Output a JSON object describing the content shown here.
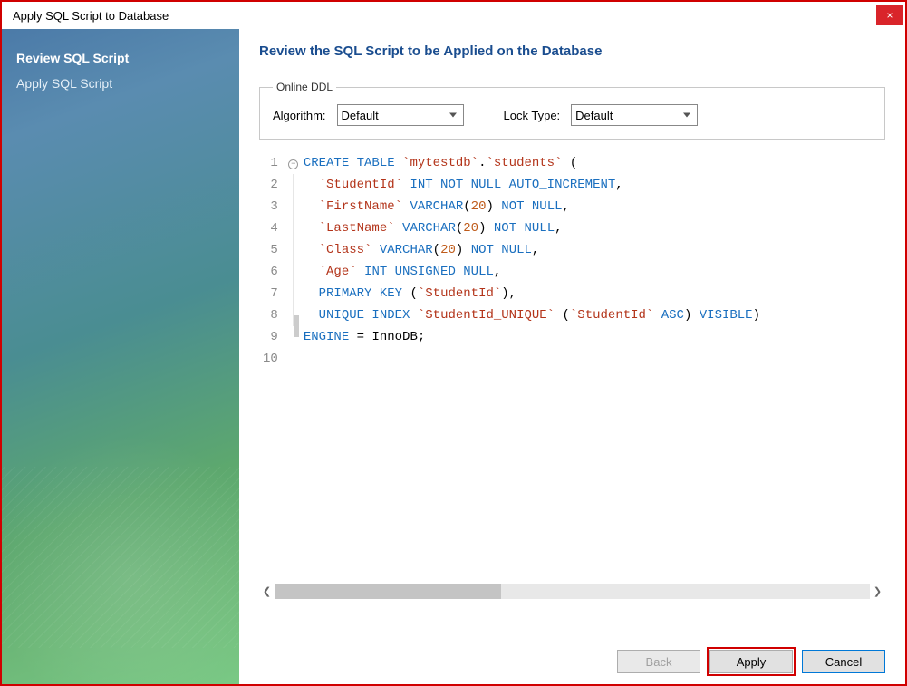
{
  "window": {
    "title": "Apply SQL Script to Database",
    "close_label": "×"
  },
  "sidebar": {
    "items": [
      {
        "label": "Review SQL Script",
        "active": true
      },
      {
        "label": "Apply SQL Script",
        "active": false
      }
    ]
  },
  "main": {
    "heading": "Review the SQL Script to be Applied on the Database",
    "fieldset": {
      "legend": "Online DDL",
      "algorithm_label": "Algorithm:",
      "algorithm_value": "Default",
      "locktype_label": "Lock Type:",
      "locktype_value": "Default"
    },
    "code": {
      "gutter": [
        "1",
        "2",
        "3",
        "4",
        "5",
        "6",
        "7",
        "8",
        "9",
        "10"
      ],
      "lines": [
        [
          {
            "t": "kw",
            "v": "CREATE TABLE"
          },
          {
            "t": "plain",
            "v": " "
          },
          {
            "t": "id",
            "v": "`mytestdb`"
          },
          {
            "t": "plain",
            "v": "."
          },
          {
            "t": "id",
            "v": "`students`"
          },
          {
            "t": "plain",
            "v": " ("
          }
        ],
        [
          {
            "t": "plain",
            "v": "  "
          },
          {
            "t": "id",
            "v": "`StudentId`"
          },
          {
            "t": "plain",
            "v": " "
          },
          {
            "t": "kw",
            "v": "INT NOT NULL AUTO_INCREMENT"
          },
          {
            "t": "plain",
            "v": ","
          }
        ],
        [
          {
            "t": "plain",
            "v": "  "
          },
          {
            "t": "id",
            "v": "`FirstName`"
          },
          {
            "t": "plain",
            "v": " "
          },
          {
            "t": "kw",
            "v": "VARCHAR"
          },
          {
            "t": "plain",
            "v": "("
          },
          {
            "t": "num",
            "v": "20"
          },
          {
            "t": "plain",
            "v": ") "
          },
          {
            "t": "kw",
            "v": "NOT NULL"
          },
          {
            "t": "plain",
            "v": ","
          }
        ],
        [
          {
            "t": "plain",
            "v": "  "
          },
          {
            "t": "id",
            "v": "`LastName`"
          },
          {
            "t": "plain",
            "v": " "
          },
          {
            "t": "kw",
            "v": "VARCHAR"
          },
          {
            "t": "plain",
            "v": "("
          },
          {
            "t": "num",
            "v": "20"
          },
          {
            "t": "plain",
            "v": ") "
          },
          {
            "t": "kw",
            "v": "NOT NULL"
          },
          {
            "t": "plain",
            "v": ","
          }
        ],
        [
          {
            "t": "plain",
            "v": "  "
          },
          {
            "t": "id",
            "v": "`Class`"
          },
          {
            "t": "plain",
            "v": " "
          },
          {
            "t": "kw",
            "v": "VARCHAR"
          },
          {
            "t": "plain",
            "v": "("
          },
          {
            "t": "num",
            "v": "20"
          },
          {
            "t": "plain",
            "v": ") "
          },
          {
            "t": "kw",
            "v": "NOT NULL"
          },
          {
            "t": "plain",
            "v": ","
          }
        ],
        [
          {
            "t": "plain",
            "v": "  "
          },
          {
            "t": "id",
            "v": "`Age`"
          },
          {
            "t": "plain",
            "v": " "
          },
          {
            "t": "kw",
            "v": "INT UNSIGNED NULL"
          },
          {
            "t": "plain",
            "v": ","
          }
        ],
        [
          {
            "t": "plain",
            "v": "  "
          },
          {
            "t": "kw",
            "v": "PRIMARY KEY"
          },
          {
            "t": "plain",
            "v": " ("
          },
          {
            "t": "id",
            "v": "`StudentId`"
          },
          {
            "t": "plain",
            "v": "),"
          }
        ],
        [
          {
            "t": "plain",
            "v": "  "
          },
          {
            "t": "kw",
            "v": "UNIQUE INDEX"
          },
          {
            "t": "plain",
            "v": " "
          },
          {
            "t": "id",
            "v": "`StudentId_UNIQUE`"
          },
          {
            "t": "plain",
            "v": " ("
          },
          {
            "t": "id",
            "v": "`StudentId`"
          },
          {
            "t": "plain",
            "v": " "
          },
          {
            "t": "kw",
            "v": "ASC"
          },
          {
            "t": "plain",
            "v": ") "
          },
          {
            "t": "kw",
            "v": "VISIBLE"
          },
          {
            "t": "plain",
            "v": ")"
          }
        ],
        [
          {
            "t": "kw",
            "v": "ENGINE"
          },
          {
            "t": "plain",
            "v": " = InnoDB;"
          }
        ],
        [
          {
            "t": "plain",
            "v": ""
          }
        ]
      ]
    }
  },
  "footer": {
    "back": "Back",
    "apply": "Apply",
    "cancel": "Cancel"
  }
}
